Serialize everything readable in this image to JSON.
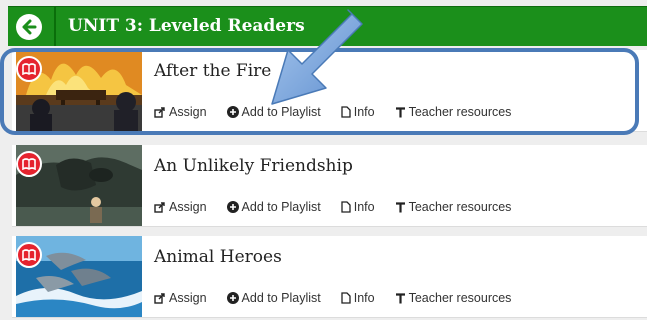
{
  "header": {
    "title": "UNIT 3: Leveled Readers",
    "back_icon": "arrow-left-circle-icon",
    "background_color": "#1b8f1b"
  },
  "actions": {
    "assign": "Assign",
    "add_to_playlist": "Add to Playlist",
    "info": "Info",
    "teacher_resources": "Teacher resources"
  },
  "readers": [
    {
      "title": "After the Fire",
      "badge_icon": "book-icon",
      "image": "fire-scene"
    },
    {
      "title": "An Unlikely Friendship",
      "badge_icon": "book-icon",
      "image": "dragon-scene"
    },
    {
      "title": "Animal Heroes",
      "badge_icon": "book-icon",
      "image": "dolphins-scene"
    }
  ],
  "colors": {
    "highlight": "#4a7ab7",
    "badge": "#e5232e",
    "arrow": "#7aa7dc"
  }
}
